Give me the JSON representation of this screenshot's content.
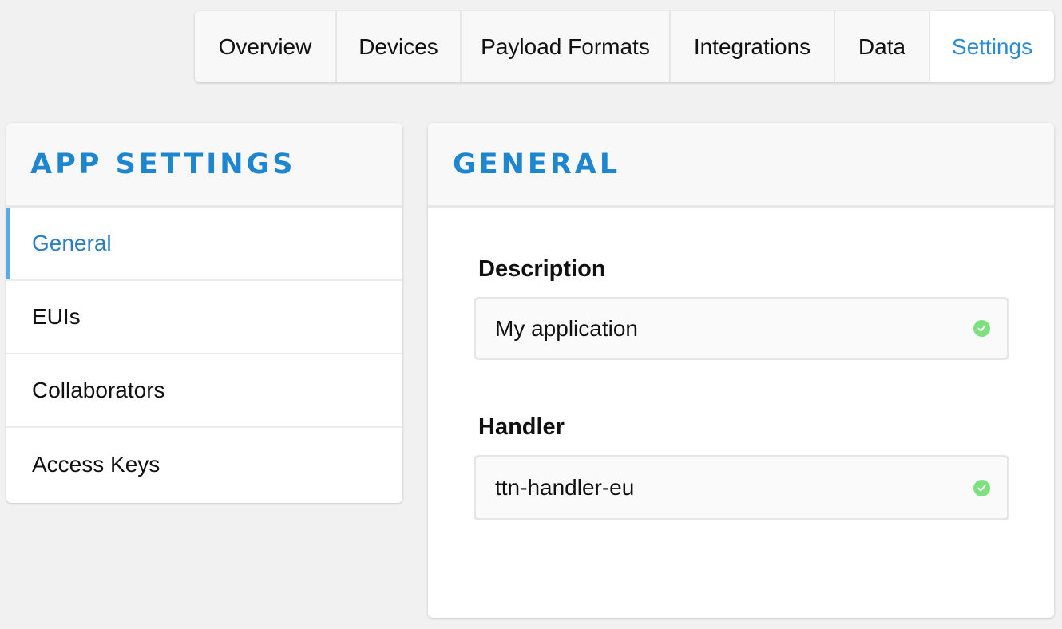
{
  "tabs": [
    {
      "label": "Overview",
      "active": false
    },
    {
      "label": "Devices",
      "active": false
    },
    {
      "label": "Payload Formats",
      "active": false
    },
    {
      "label": "Integrations",
      "active": false
    },
    {
      "label": "Data",
      "active": false
    },
    {
      "label": "Settings",
      "active": true
    }
  ],
  "sidebar": {
    "title": "APP SETTINGS",
    "items": [
      {
        "label": "General",
        "active": true
      },
      {
        "label": "EUIs",
        "active": false
      },
      {
        "label": "Collaborators",
        "active": false
      },
      {
        "label": "Access Keys",
        "active": false
      }
    ]
  },
  "main": {
    "title": "GENERAL",
    "fields": {
      "description": {
        "label": "Description",
        "value": "My application",
        "status_icon": "check-circle-icon"
      },
      "handler": {
        "label": "Handler",
        "value": "ttn-handler-eu",
        "status_icon": "check-circle-icon"
      }
    }
  },
  "colors": {
    "accent": "#1e86cf",
    "active_tab": "#2a8ad4",
    "valid": "#7ee07f",
    "background": "#f1f1f1"
  }
}
